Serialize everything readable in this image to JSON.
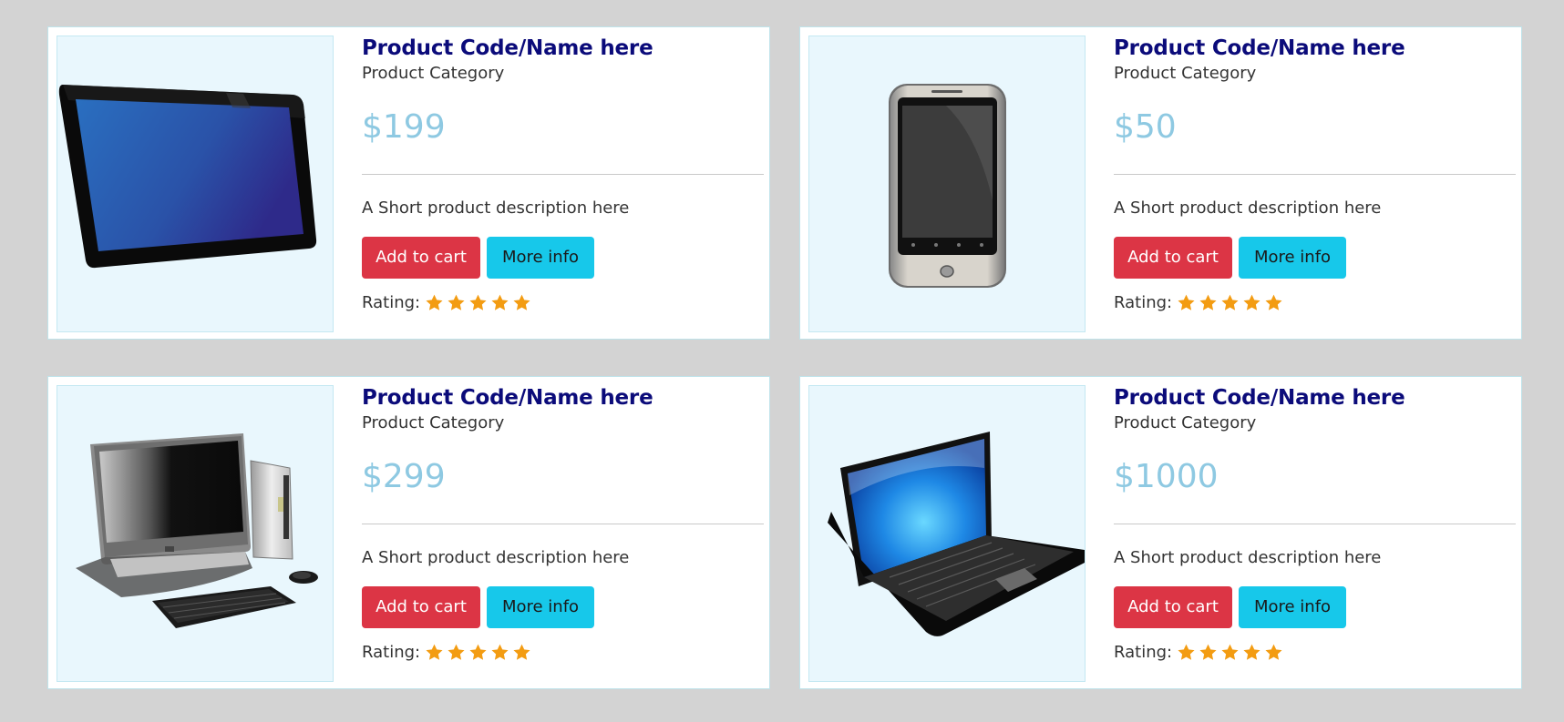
{
  "products": [
    {
      "title": "Product Code/Name here",
      "category": "Product Category",
      "price": "$199",
      "description": "A Short product description here",
      "add_to_cart_label": "Add to cart",
      "more_info_label": "More info",
      "rating_label": "Rating:",
      "rating": 5,
      "image": "tablet-image"
    },
    {
      "title": "Product Code/Name here",
      "category": "Product Category",
      "price": "$50",
      "description": "A Short product description here",
      "add_to_cart_label": "Add to cart",
      "more_info_label": "More info",
      "rating_label": "Rating:",
      "rating": 5,
      "image": "smartphone-image"
    },
    {
      "title": "Product Code/Name here",
      "category": "Product Category",
      "price": "$299",
      "description": "A Short product description here",
      "add_to_cart_label": "Add to cart",
      "more_info_label": "More info",
      "rating_label": "Rating:",
      "rating": 5,
      "image": "desktop-computer-image"
    },
    {
      "title": "Product Code/Name here",
      "category": "Product Category",
      "price": "$1000",
      "description": "A Short product description here",
      "add_to_cart_label": "Add to cart",
      "more_info_label": "More info",
      "rating_label": "Rating:",
      "rating": 5,
      "image": "laptop-image"
    }
  ],
  "colors": {
    "page_background": "#d3d3d3",
    "title": "#0b0b7a",
    "price": "#8ec9e2",
    "add_to_cart": "#dc3545",
    "more_info": "#17c8ea",
    "star": "#f39c12",
    "image_background": "#e9f7fd"
  }
}
